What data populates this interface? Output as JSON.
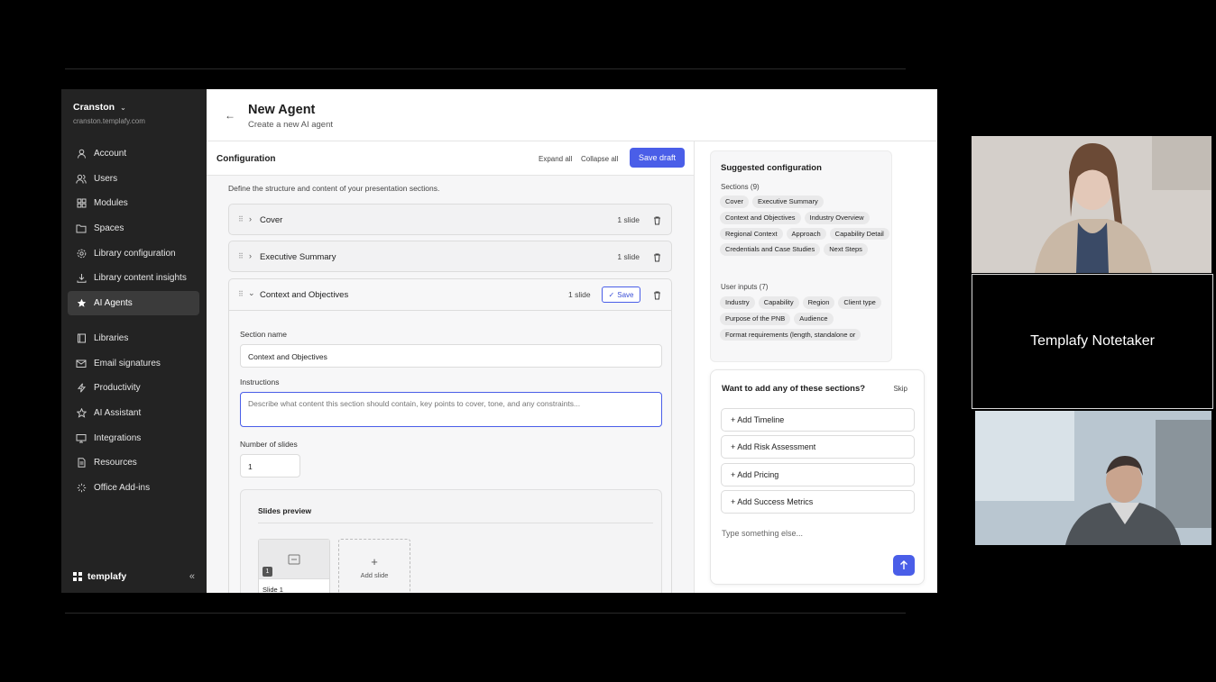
{
  "sidebar": {
    "org_name": "Cranston",
    "org_domain": "cranston.templafy.com",
    "items_top": [
      {
        "label": "Account",
        "icon": "user-icon"
      },
      {
        "label": "Users",
        "icon": "users-icon"
      },
      {
        "label": "Modules",
        "icon": "grid-icon"
      },
      {
        "label": "Spaces",
        "icon": "folder-icon"
      },
      {
        "label": "Library configuration",
        "icon": "gear-icon"
      },
      {
        "label": "Library content insights",
        "icon": "download-icon"
      },
      {
        "label": "AI Agents",
        "icon": "star-icon",
        "active": true
      }
    ],
    "items_bottom": [
      {
        "label": "Libraries",
        "icon": "book-icon"
      },
      {
        "label": "Email signatures",
        "icon": "mail-icon"
      },
      {
        "label": "Productivity",
        "icon": "bolt-icon"
      },
      {
        "label": "AI Assistant",
        "icon": "star-outline-icon"
      },
      {
        "label": "Integrations",
        "icon": "monitor-icon"
      },
      {
        "label": "Resources",
        "icon": "document-icon"
      },
      {
        "label": "Office Add-ins",
        "icon": "loader-icon"
      }
    ],
    "brand": "templafy",
    "collapse_label": "«"
  },
  "header": {
    "title": "New Agent",
    "subtitle": "Create a new AI agent"
  },
  "config": {
    "title": "Configuration",
    "expand_all": "Expand all",
    "collapse_all": "Collapse all",
    "save_draft": "Save draft",
    "description": "Define the structure and content of your presentation sections.",
    "sections": [
      {
        "name": "Cover",
        "count": "1 slide"
      },
      {
        "name": "Executive Summary",
        "count": "1 slide"
      }
    ],
    "expanded": {
      "name": "Context and Objectives",
      "count": "1 slide",
      "save_label": "Save",
      "section_name_label": "Section name",
      "section_name_value": "Context and Objectives",
      "instructions_label": "Instructions",
      "instructions_placeholder": "Describe what content this section should contain, key points to cover, tone, and any constraints...",
      "slides_label": "Number of slides",
      "slides_value": "1",
      "preview_title": "Slides preview",
      "slide_label": "Slide 1",
      "slide_num": "1",
      "add_slide": "Add slide"
    }
  },
  "suggested": {
    "title": "Suggested configuration",
    "sections_label": "Sections (9)",
    "sections": [
      "Cover",
      "Executive Summary",
      "Context and Objectives",
      "Industry Overview",
      "Regional Context",
      "Approach",
      "Capability Detail",
      "Credentials and Case Studies",
      "Next Steps"
    ],
    "inputs_label": "User inputs (7)",
    "inputs": [
      "Industry",
      "Capability",
      "Region",
      "Client type",
      "Purpose of the PNB",
      "Audience",
      "Format requirements (length, standalone or"
    ]
  },
  "chat": {
    "question": "Want to add any of these sections?",
    "skip": "Skip",
    "options": [
      "+ Add Timeline",
      "+ Add Risk Assessment",
      "+ Add Pricing",
      "+ Add Success Metrics"
    ],
    "placeholder": "Type something else..."
  },
  "video": {
    "notetaker_label": "Templafy Notetaker"
  }
}
